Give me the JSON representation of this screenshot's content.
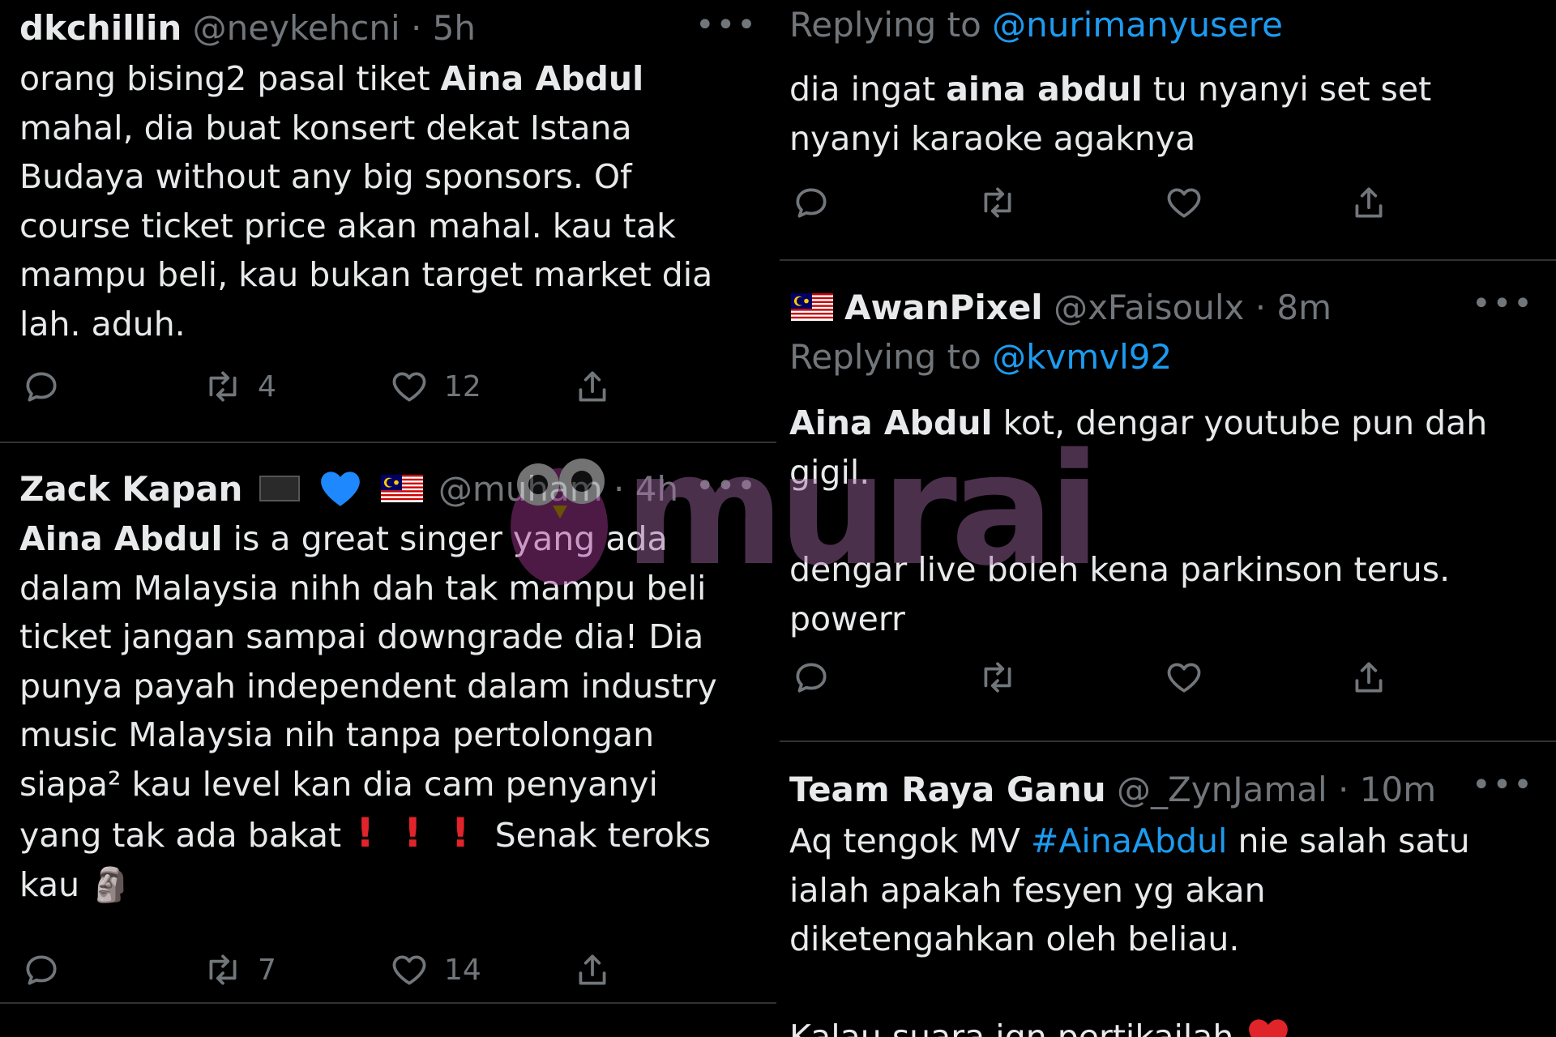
{
  "left": {
    "tweet1": {
      "name": "dkchillin",
      "handle": "@neykehcni",
      "sep": " · ",
      "time": "5h",
      "more": "•••",
      "text_a": "orang bising2 pasal tiket ",
      "text_bold": "Aina Abdul",
      "text_b": " mahal, dia buat konsert dekat Istana Budaya without any big sponsors. Of course ticket price akan mahal. kau tak mampu beli, kau bukan target market dia lah. aduh.",
      "retweets": "4",
      "likes": "12"
    },
    "tweet2": {
      "name": "Zack Kapan",
      "handle": "@muham",
      "sep": " · ",
      "time": "4h",
      "more": "•••",
      "text_bold": "Aina Abdul",
      "text_a": " is a great singer yang ada dalam Malaysia nihh dah tak mampu beli ticket jangan sampai downgrade dia! Dia punya payah independent dalam industry music Malaysia nih tanpa pertolongan siapa² kau level kan dia cam penyanyi yang tak ada bakat",
      "bangs": [
        "!",
        "!",
        "!"
      ],
      "text_b": " Senak teroks kau",
      "moai": "🗿",
      "retweets": "7",
      "likes": "14"
    }
  },
  "right": {
    "tweet1": {
      "replying_prefix": "Replying to ",
      "replying_to": "@nurimanyusere",
      "text_a": "dia ingat ",
      "text_bold": "aina abdul",
      "text_b": " tu nyanyi set set nyanyi karaoke agaknya"
    },
    "tweet2": {
      "name": "AwanPixel",
      "handle": "@xFaisoulx",
      "sep": " · ",
      "time": "8m",
      "more": "•••",
      "replying_prefix": "Replying to ",
      "replying_to": "@kvmvl92",
      "text_bold": "Aina Abdul",
      "text_a": " kot, dengar youtube pun dah gigil.",
      "text_b": "dengar live boleh kena parkinson terus. powerr"
    },
    "tweet3": {
      "name": "Team Raya Ganu",
      "handle": "@_ZynJamal",
      "sep": " · ",
      "time": "10m",
      "more": "•••",
      "text_a": "Aq tengok MV ",
      "hashtag": "#AinaAbdul",
      "text_b": " nie salah satu ialah apakah fesyen yg akan diketengahkan oleh beliau.",
      "text_c": "Kalau suara jgn pertikailah"
    }
  },
  "watermark": {
    "text": "murai"
  },
  "colors": {
    "background": "#000000",
    "text": "#e7e9ea",
    "muted": "#71767b",
    "link": "#1d9bf0",
    "divider": "#2f3336"
  }
}
